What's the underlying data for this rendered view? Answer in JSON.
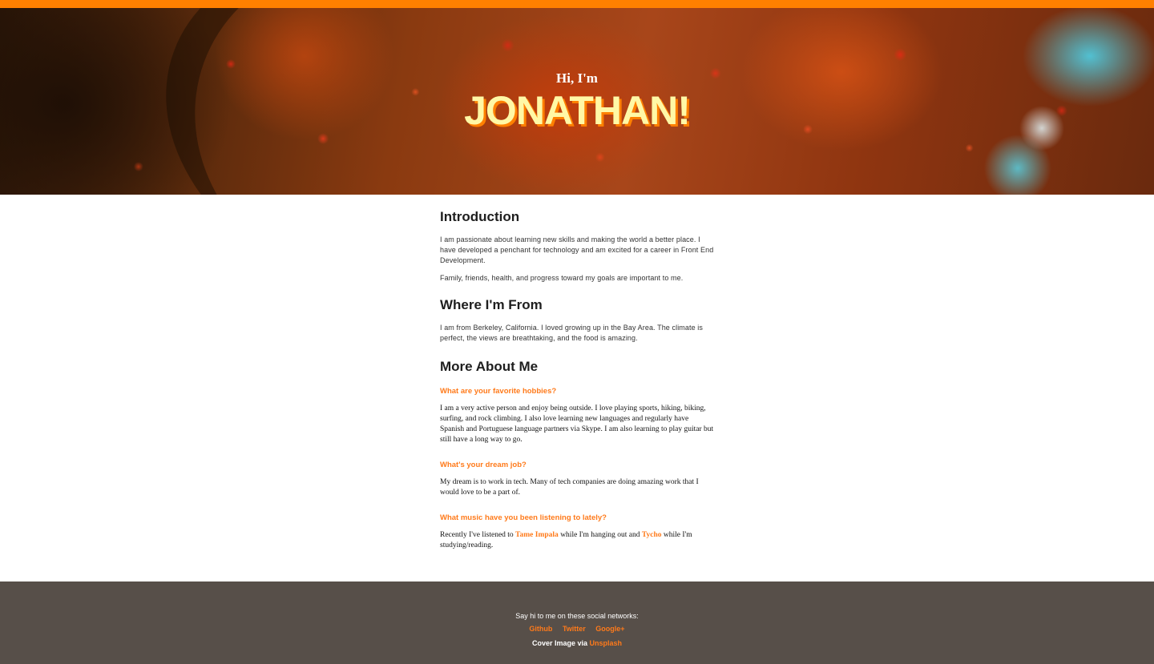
{
  "hero": {
    "greeting": "Hi, I'm",
    "name": "JONATHAN!"
  },
  "introduction": {
    "heading": "Introduction",
    "paragraphs": [
      "I am passionate about learning new skills and making the world a better place. I have developed a penchant for technology and am excited for a career in Front End Development.",
      "Family, friends, health, and progress toward my goals are important to me."
    ]
  },
  "where_from": {
    "heading": "Where I'm From",
    "paragraph": "I am from Berkeley, California. I loved growing up in the Bay Area. The climate is perfect, the views are breathtaking, and the food is amazing."
  },
  "more_about": {
    "heading": "More About Me",
    "q1": {
      "question": "What are your favorite hobbies?",
      "answer": "I am a very active person and enjoy being outside. I love playing sports, hiking, biking, surfing, and rock climbing. I also love learning new languages and regularly have Spanish and Portuguese language partners via Skype. I am also learning to play guitar but still have a long way to go."
    },
    "q2": {
      "question": "What's your dream job?",
      "answer": "My dream is to work in tech. Many of tech companies are doing amazing work that I would love to be a part of."
    },
    "q3": {
      "question": "What music have you been listening to lately?",
      "answer_prefix": "Recently I've listened to ",
      "link1": "Tame Impala",
      "answer_middle": " while I'm hanging out and ",
      "link2": "Tycho",
      "answer_suffix": " while I'm studying/reading."
    }
  },
  "footer": {
    "say_hi": "Say hi to me on these social networks:",
    "links": [
      "Github",
      "Twitter",
      "Google+"
    ],
    "credit_prefix": "Cover Image via ",
    "credit_link": "Unsplash"
  },
  "colors": {
    "accent": "#ff8000",
    "link": "#ff7a1a",
    "name_fill": "#fff8a6",
    "footer_bg": "#574f49"
  }
}
